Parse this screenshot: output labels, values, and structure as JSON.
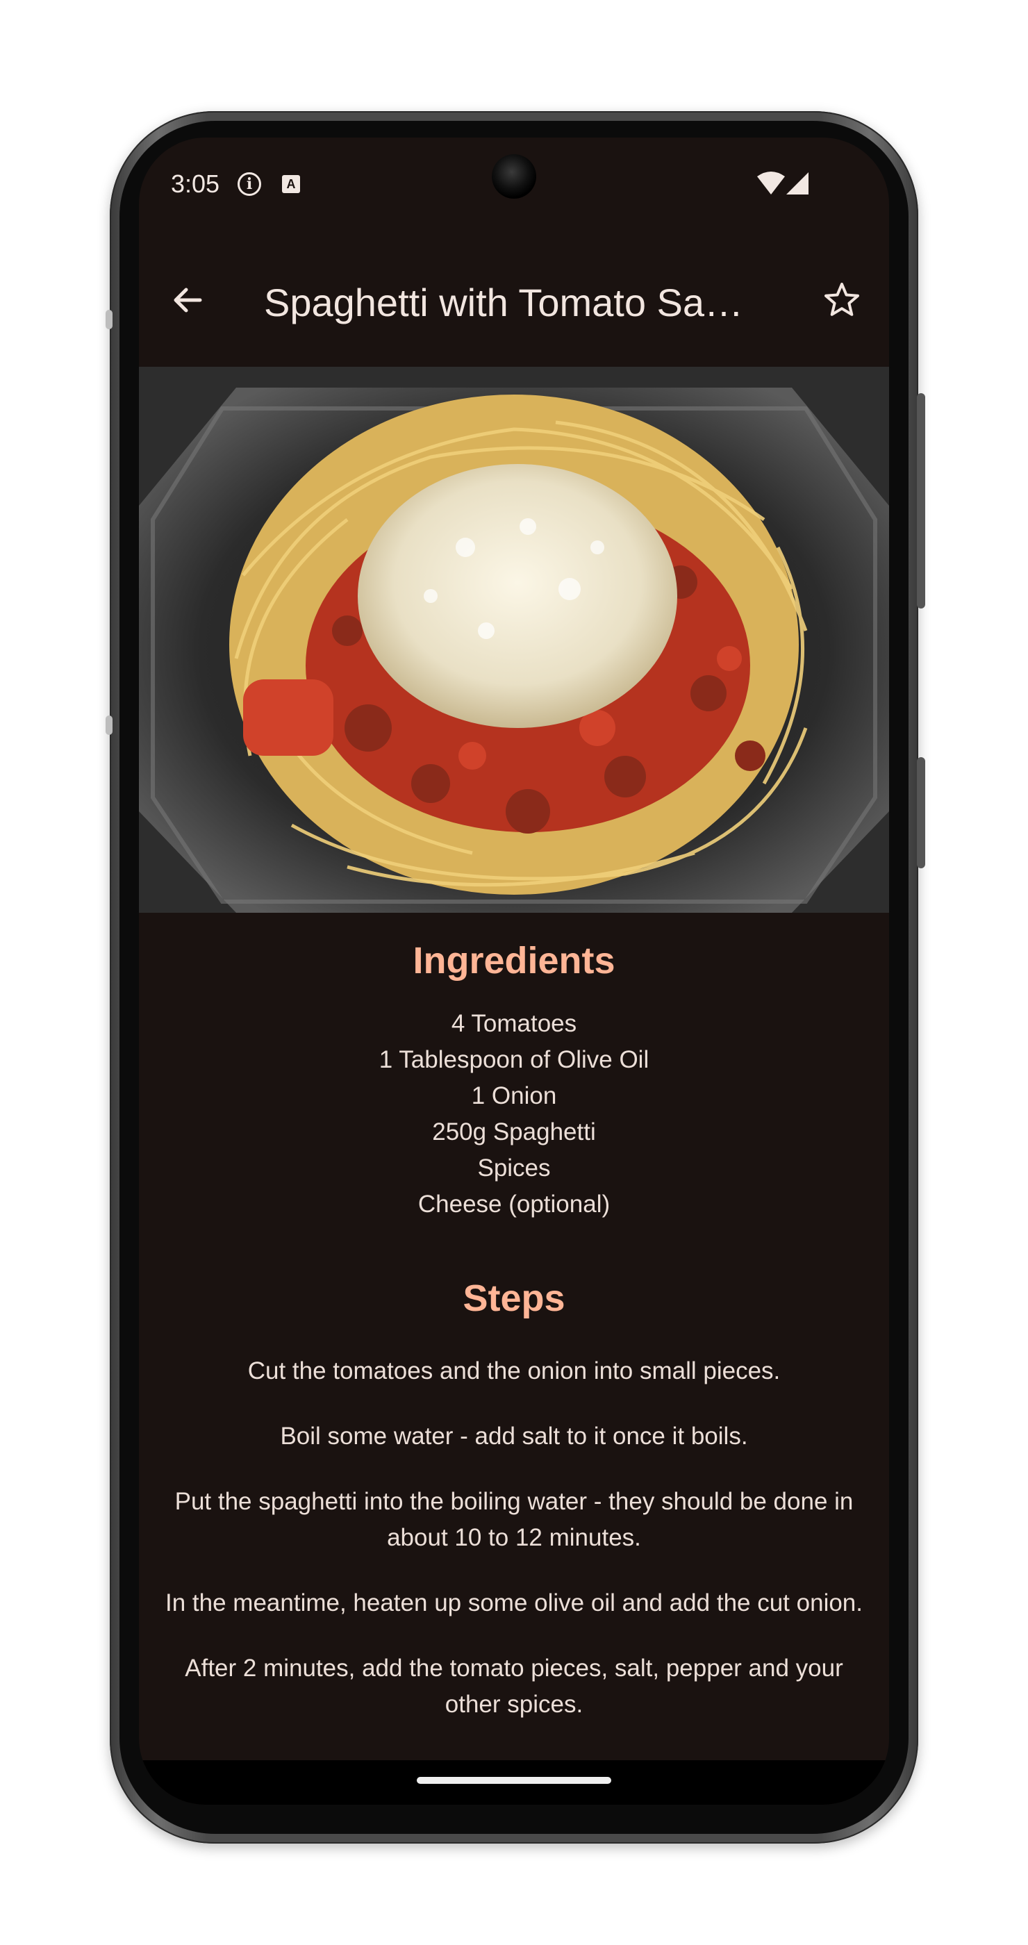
{
  "status_bar": {
    "time": "3:05",
    "icons": [
      "info-icon",
      "text-a-icon",
      "wifi-icon",
      "signal-icon"
    ]
  },
  "app_bar": {
    "title": "Spaghetti with Tomato Sauce",
    "back_icon": "arrow-left-icon",
    "favorite_icon": "star-outline-icon"
  },
  "hero_image": {
    "alt": "Spaghetti with tomato sauce and grated cheese"
  },
  "ingredients": {
    "heading": "Ingredients",
    "items": [
      "4 Tomatoes",
      "1 Tablespoon of Olive Oil",
      "1 Onion",
      "250g Spaghetti",
      "Spices",
      "Cheese (optional)"
    ]
  },
  "steps": {
    "heading": "Steps",
    "items": [
      "Cut the tomatoes and the onion into small pieces.",
      "Boil some water - add salt to it once it boils.",
      "Put the spaghetti into the boiling water - they should be done in about 10 to 12 minutes.",
      "In the meantime, heaten up some olive oil and add the cut onion.",
      "After 2 minutes, add the tomato pieces, salt, pepper and your other spices."
    ]
  },
  "colors": {
    "background": "#1a1210",
    "accent": "#ffb596",
    "text": "#ecdfd8"
  }
}
